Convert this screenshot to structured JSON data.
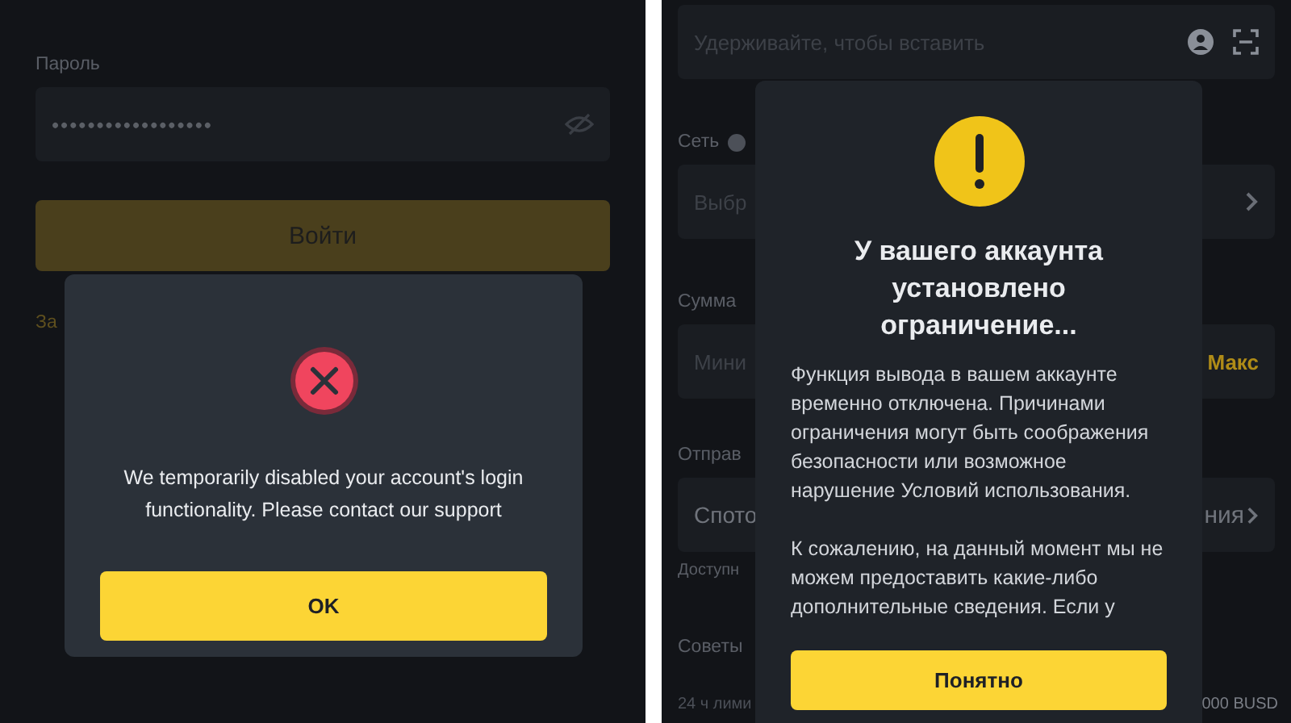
{
  "login_screen": {
    "password_label": "Пароль",
    "password_value": "••••••••••••••••••",
    "login_button": "Войти",
    "forgot_link": "За",
    "dialog": {
      "kind": "error",
      "message": "We temporarily disabled your account's login functionality. Please contact our support",
      "button": "OK"
    }
  },
  "withdraw_screen": {
    "address_placeholder": "Удерживайте, чтобы вставить",
    "network_label": "Сеть",
    "network_value": "Выбр",
    "amount_label": "Сумма",
    "amount_placeholder": "Мини",
    "max_button": "Макс",
    "from_label": "Отправ",
    "from_value": "Спото",
    "from_value_end": "ния",
    "available_label": "Доступн",
    "tips_label": "Советы",
    "limit_label": "24 ч лими",
    "limit_value": "000 BUSD",
    "dialog": {
      "kind": "warning",
      "title": "У вашего аккаунта установлено ограничение...",
      "paragraphs": [
        "Функция вывода в вашем аккаунте временно отключена. Причинами ограничения могут быть соображения безопасности или возможное нарушение Условий использования.",
        "К сожалению, на данный момент мы не можем предоставить какие-либо дополнительные сведения. Если у"
      ],
      "button": "Понятно"
    }
  }
}
